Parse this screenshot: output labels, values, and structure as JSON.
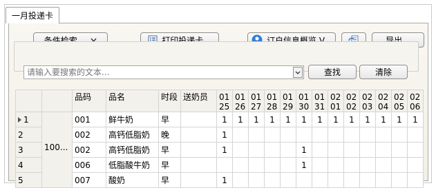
{
  "tab": {
    "label": "一月投递卡"
  },
  "toolbar": {
    "filter_label": "条件检索...",
    "print_label": "打印投递卡...",
    "overview_label": "订户信息概览 V...",
    "export_label": "导出..."
  },
  "search": {
    "placeholder": "请输入要搜索的文本...",
    "find_label": "查找",
    "clear_label": "清除"
  },
  "grid": {
    "headers": [
      "品码",
      "品名",
      "时段",
      "送奶员"
    ],
    "dates": [
      {
        "m": "01",
        "d": "25"
      },
      {
        "m": "01",
        "d": "26"
      },
      {
        "m": "01",
        "d": "27"
      },
      {
        "m": "01",
        "d": "28"
      },
      {
        "m": "01",
        "d": "29"
      },
      {
        "m": "01",
        "d": "30"
      },
      {
        "m": "01",
        "d": "31"
      },
      {
        "m": "02",
        "d": "01"
      },
      {
        "m": "02",
        "d": "02"
      },
      {
        "m": "02",
        "d": "03"
      },
      {
        "m": "02",
        "d": "04"
      },
      {
        "m": "02",
        "d": "05"
      },
      {
        "m": "02",
        "d": "06"
      }
    ],
    "group_label": "100...",
    "rows": [
      {
        "idx": "1",
        "code": "001",
        "name": "鲜牛奶",
        "period": "早",
        "courier": "",
        "vals": [
          "1",
          "1",
          "1",
          "1",
          "1",
          "1",
          "1",
          "1",
          "1",
          "1",
          "1",
          "1",
          "1"
        ]
      },
      {
        "idx": "2",
        "code": "002",
        "name": "高钙低脂奶",
        "period": "晚",
        "courier": "",
        "vals": [
          "1",
          "",
          "",
          "",
          "",
          "",
          "",
          "",
          "",
          "",
          "",
          "",
          ""
        ]
      },
      {
        "idx": "3",
        "code": "002",
        "name": "高钙低脂奶",
        "period": "早",
        "courier": "",
        "vals": [
          "1",
          "",
          "",
          "",
          "",
          "1",
          "",
          "",
          "",
          "",
          "",
          "",
          ""
        ]
      },
      {
        "idx": "4",
        "code": "006",
        "name": "低脂酸牛奶",
        "period": "早",
        "courier": "",
        "vals": [
          "",
          "",
          "",
          "",
          "",
          "1",
          "",
          "",
          "",
          "",
          "",
          "",
          ""
        ]
      },
      {
        "idx": "5",
        "code": "007",
        "name": "酸奶",
        "period": "早",
        "courier": "",
        "vals": [
          "1",
          "",
          "",
          "",
          "",
          "",
          "",
          "",
          "",
          "",
          "",
          "",
          ""
        ]
      }
    ]
  }
}
